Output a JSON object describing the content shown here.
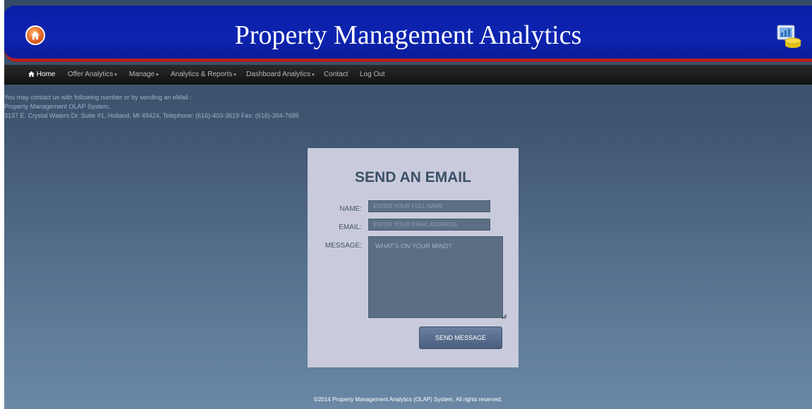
{
  "header": {
    "title": "Property Management Analytics",
    "home_icon": "home-circle-icon",
    "brand_icon": "database-chart-icon"
  },
  "nav": {
    "items": [
      {
        "label": "Home",
        "icon": "home-icon",
        "active": true
      },
      {
        "label": "Offer Analytics",
        "dropdown": true
      },
      {
        "label": "Manage",
        "dropdown": true
      },
      {
        "label": "Analytics & Reports",
        "dropdown": true
      },
      {
        "label": "Dashboard Analytics",
        "dropdown": true
      },
      {
        "label": "Contact"
      },
      {
        "label": "Log Out"
      }
    ],
    "caret": "▾"
  },
  "contact_info": {
    "line1": "You may contact us with following number or by sending an eMail :",
    "line2": "Property Management OLAP System.",
    "line3": "3137 E. Crystal Waters Dr. Suite #1, Holland, MI 49424, Telephone: (616)-403-3619 Fax: (616)-394-7685"
  },
  "form": {
    "title": "SEND AN EMAIL",
    "name_label": "NAME:",
    "name_placeholder": "ENTER YOUR FULL NAME",
    "email_label": "EMAIL:",
    "email_placeholder": "ENTER YOUR EMAIL ADDRESS",
    "message_label": "MESSAGE:",
    "message_placeholder": "WHAT'S ON YOUR MIND?",
    "submit_label": "SEND MESSAGE"
  },
  "footer": {
    "text": "©2014 Property Management Analytics (OLAP) System, All rights reserved."
  },
  "colors": {
    "header_blue": "#0d24b0",
    "header_border_red": "#b2201d",
    "card_bg": "#c9cbdc",
    "button": "#5a6f8e"
  }
}
